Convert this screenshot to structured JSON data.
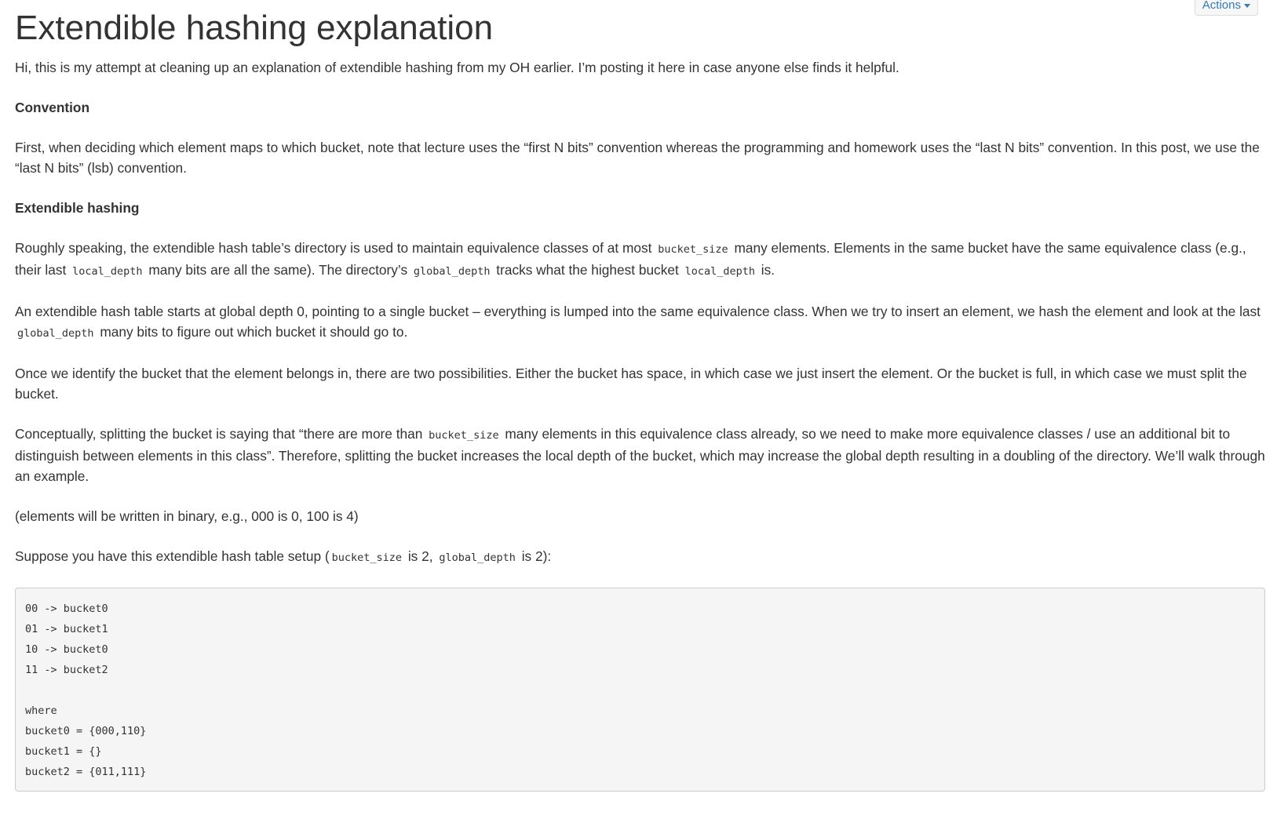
{
  "post": {
    "title": "Extendible hashing explanation",
    "actions_label": "Actions"
  },
  "content": {
    "intro": "Hi, this is my attempt at cleaning up an explanation of extendible hashing from my OH earlier. I’m posting it here in case anyone else finds it helpful.",
    "heading_convention": "Convention",
    "convention_text": "First, when deciding which element maps to which bucket, note that lecture uses the “first N bits” convention whereas the programming and homework uses the “last N bits” convention. In this post, we use the “last N bits” (lsb) convention.",
    "heading_extendible": "Extendible hashing",
    "p1": {
      "a": "Roughly speaking, the extendible hash table’s directory is used to maintain equivalence classes of at most",
      "code1": "bucket_size",
      "b": "many elements. Elements in the same bucket have the same equivalence class (e.g., their last",
      "code2": "local_depth",
      "c": "many bits are all the same). The directory’s",
      "code3": "global_depth",
      "d": "tracks what the highest bucket",
      "code4": "local_depth",
      "e": "is."
    },
    "p2": {
      "a": "An extendible hash table starts at global depth 0, pointing to a single bucket – everything is lumped into the same equivalence class. When we try to insert an element, we hash the element and look at the last",
      "code1": "global_depth",
      "b": "many bits to figure out which bucket it should go to."
    },
    "p3": "Once we identify the bucket that the element belongs in, there are two possibilities. Either the bucket has space, in which case we just insert the element. Or the bucket is full, in which case we must split the bucket.",
    "p4": {
      "a": "Conceptually, splitting the bucket is saying that “there are more than",
      "code1": "bucket_size",
      "b": "many elements in this equivalence class already, so we need to make more equivalence classes / use an additional bit to distinguish between elements in this class”. Therefore, splitting the bucket increases the local depth of the bucket, which may increase the global depth resulting in a doubling of the directory. We’ll walk through an example."
    },
    "p5": "(elements will be written in binary, e.g., 000 is 0, 100 is 4)",
    "p6": {
      "a": "Suppose you have this extendible hash table setup (",
      "code1": "bucket_size",
      "b": "is 2,",
      "code2": "global_depth",
      "c": "is 2):"
    },
    "code_block": "00 -> bucket0\n01 -> bucket1\n10 -> bucket0\n11 -> bucket2\n\nwhere\nbucket0 = {000,110}\nbucket1 = {}\nbucket2 = {011,111}"
  }
}
